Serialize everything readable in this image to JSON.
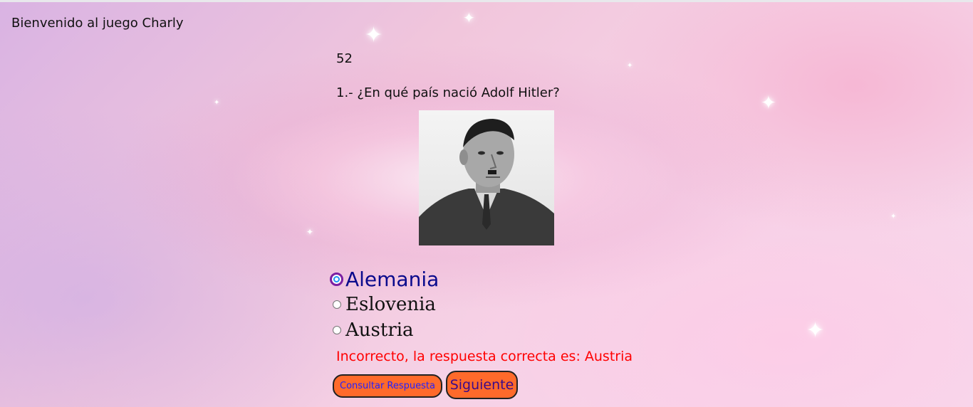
{
  "header": {
    "welcome_text": "Bienvenido al juego Charly"
  },
  "score": {
    "value": "52"
  },
  "question": {
    "text": "1.- ¿En qué país nació Adolf Hitler?",
    "image_icon": "portrait-photo"
  },
  "options": [
    {
      "label": "Alemania",
      "selected": true
    },
    {
      "label": "Eslovenia",
      "selected": false
    },
    {
      "label": "Austria",
      "selected": false
    }
  ],
  "feedback": {
    "text": "Incorrecto, la respuesta correcta es: Austria",
    "color": "#ff0000"
  },
  "buttons": {
    "check_label": "Consultar Respuesta",
    "next_label": "Siguiente",
    "color": "#ff6a2b"
  }
}
